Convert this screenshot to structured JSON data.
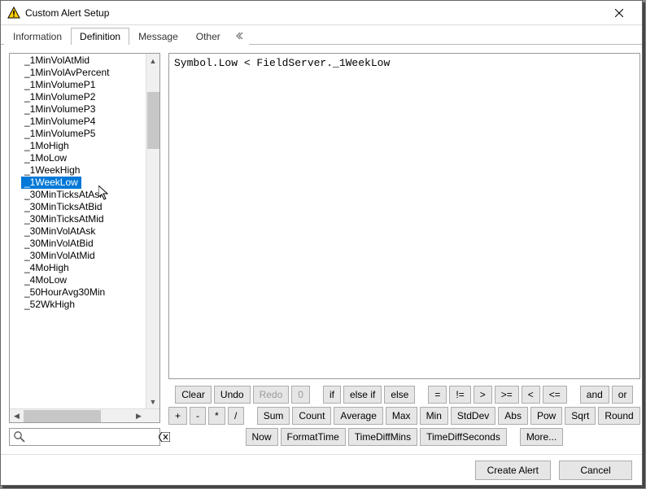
{
  "window": {
    "title": "Custom Alert Setup"
  },
  "tabs": {
    "items": [
      "Information",
      "Definition",
      "Message",
      "Other"
    ],
    "active_index": 1
  },
  "fieldList": {
    "items": [
      "_1MinVolAtMid",
      "_1MinVolAvPercent",
      "_1MinVolumeP1",
      "_1MinVolumeP2",
      "_1MinVolumeP3",
      "_1MinVolumeP4",
      "_1MinVolumeP5",
      "_1MoHigh",
      "_1MoLow",
      "_1WeekHigh",
      "_1WeekLow",
      "_30MinTicksAtAsk",
      "_30MinTicksAtBid",
      "_30MinTicksAtMid",
      "_30MinVolAtAsk",
      "_30MinVolAtBid",
      "_30MinVolAtMid",
      "_4MoHigh",
      "_4MoLow",
      "_50HourAvg30Min",
      "_52WkHigh"
    ],
    "selected_index": 10
  },
  "search": {
    "value": "",
    "placeholder": ""
  },
  "editor": {
    "content": "Symbol.Low < FieldServer._1WeekLow"
  },
  "toolbar": {
    "row1": {
      "clear": "Clear",
      "undo": "Undo",
      "redo": "Redo",
      "zero": "0",
      "if": "if",
      "elseif": "else if",
      "else": "else",
      "eq": "=",
      "neq": "!=",
      "gt": ">",
      "gte": ">=",
      "lt": "<",
      "lte": "<=",
      "and": "and",
      "or": "or"
    },
    "row2": {
      "plus": "+",
      "minus": "-",
      "mult": "*",
      "div": "/",
      "sum": "Sum",
      "count": "Count",
      "avg": "Average",
      "max": "Max",
      "min": "Min",
      "stddev": "StdDev",
      "abs": "Abs",
      "pow": "Pow",
      "sqrt": "Sqrt",
      "round": "Round"
    },
    "row3": {
      "now": "Now",
      "fmttime": "FormatTime",
      "tdmins": "TimeDiffMins",
      "tdsecs": "TimeDiffSeconds",
      "more": "More..."
    }
  },
  "footer": {
    "create": "Create Alert",
    "cancel": "Cancel"
  }
}
